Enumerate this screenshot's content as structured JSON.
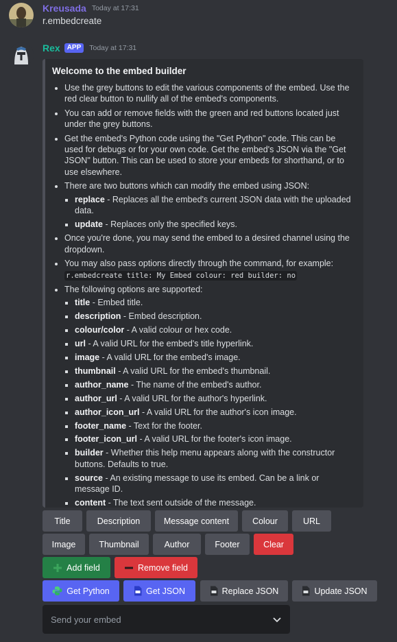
{
  "messages": [
    {
      "username": "Kreusada",
      "username_color": "#7f6ee3",
      "timestamp": "Today at 17:31",
      "content": "r.embedcreate"
    },
    {
      "username": "Rex",
      "username_color": "#1abc9c",
      "badge": "APP",
      "timestamp": "Today at 17:31"
    }
  ],
  "embed": {
    "title": "Welcome to the embed builder",
    "bullets": {
      "b1": "Use the grey buttons to edit the various components of the embed. Use the red clear button to nullify all of the embed's components.",
      "b2": "You can add or remove fields with the green and red buttons located just under the grey buttons.",
      "b3": "Get the embed's Python code using the \"Get Python\" code. This can be used for debugs or for your own code. Get the embed's JSON via the \"Get JSON\" button. This can be used to store your embeds for shorthand, or to use elsewhere.",
      "b4": "There are two buttons which can modify the embed using JSON:",
      "b5": "Once you're done, you may send the embed to a desired channel using the dropdown.",
      "b6": "You may also pass options directly through the command, for example:",
      "b6_code": "r.embedcreate title: My Embed colour: red builder: no",
      "b7": "The following options are supported:"
    },
    "json_modes": [
      {
        "key": "replace",
        "desc": " - Replaces all the embed's current JSON data with the uploaded data."
      },
      {
        "key": "update",
        "desc": " - Replaces only the specified keys."
      }
    ],
    "options": [
      {
        "key": "title",
        "desc": " - Embed title."
      },
      {
        "key": "description",
        "desc": " - Embed description."
      },
      {
        "key": "colour/color",
        "desc": " - A valid colour or hex code."
      },
      {
        "key": "url",
        "desc": " - A valid URL for the embed's title hyperlink."
      },
      {
        "key": "image",
        "desc": " - A valid URL for the embed's image."
      },
      {
        "key": "thumbnail",
        "desc": " - A valid URL for the embed's thumbnail."
      },
      {
        "key": "author_name",
        "desc": " - The name of the embed's author."
      },
      {
        "key": "author_url",
        "desc": " - A valid URL for the author's hyperlink."
      },
      {
        "key": "author_icon_url",
        "desc": " - A valid URL for the author's icon image."
      },
      {
        "key": "footer_name",
        "desc": " - Text for the footer."
      },
      {
        "key": "footer_icon_url",
        "desc": " - A valid URL for the footer's icon image."
      },
      {
        "key": "builder",
        "desc": " - Whether this help menu appears along with the constructor buttons. Defaults to true."
      },
      {
        "key": "source",
        "desc": " - An existing message to use its embed. Can be a link or message ID."
      },
      {
        "key": "content",
        "desc": " - The text sent outside of the message."
      }
    ]
  },
  "buttons": {
    "title": "Title",
    "description": "Description",
    "message_content": "Message content",
    "colour": "Colour",
    "url": "URL",
    "image": "Image",
    "thumbnail": "Thumbnail",
    "author": "Author",
    "footer": "Footer",
    "clear": "Clear",
    "add_field": "Add field",
    "remove_field": "Remove field",
    "get_python": "Get Python",
    "get_json": "Get JSON",
    "replace_json": "Replace JSON",
    "update_json": "Update JSON"
  },
  "select": {
    "placeholder": "Send your embed"
  },
  "colors": {
    "grey_button": "#4e5058",
    "red_button": "#da373c",
    "green_button": "#248046",
    "blurple_button": "#5865f2"
  },
  "icons": [
    "plus-icon",
    "minus-icon",
    "python-logo-icon",
    "json-file-icon",
    "chevron-down-icon"
  ]
}
